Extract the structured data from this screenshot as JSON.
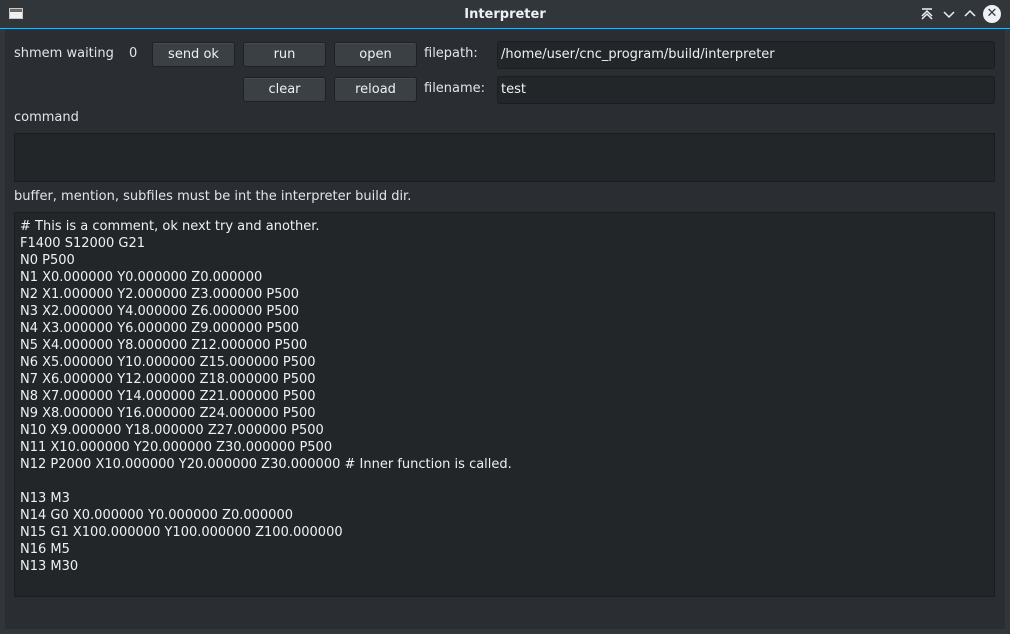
{
  "window": {
    "title": "Interpreter",
    "controls": [
      "keep-above-icon",
      "minimize-icon",
      "maximize-icon",
      "close-icon"
    ]
  },
  "toolbar": {
    "shmem_label": "shmem waiting",
    "shmem_count": "0",
    "send_ok": "send ok",
    "run": "run",
    "open": "open",
    "clear": "clear",
    "reload": "reload",
    "filepath_label": "filepath:",
    "filepath_value": "/home/user/cnc_program/build/interpreter",
    "filename_label": "filename:",
    "filename_value": "test"
  },
  "command": {
    "label": "command",
    "value": ""
  },
  "notice": "buffer, mention, subfiles must be int the interpreter build dir.",
  "editor": {
    "lines": [
      "# This is a comment, ok next try and another.",
      "F1400 S12000 G21",
      "N0 P500",
      "N1 X0.000000 Y0.000000 Z0.000000",
      "N2 X1.000000 Y2.000000 Z3.000000 P500",
      "N3 X2.000000 Y4.000000 Z6.000000 P500",
      "N4 X3.000000 Y6.000000 Z9.000000 P500",
      "N5 X4.000000 Y8.000000 Z12.000000 P500",
      "N6 X5.000000 Y10.000000 Z15.000000 P500",
      "N7 X6.000000 Y12.000000 Z18.000000 P500",
      "N8 X7.000000 Y14.000000 Z21.000000 P500",
      "N9 X8.000000 Y16.000000 Z24.000000 P500",
      "N10 X9.000000 Y18.000000 Z27.000000 P500",
      "N11 X10.000000 Y20.000000 Z30.000000 P500",
      "N12 P2000 X10.000000 Y20.000000 Z30.000000 # Inner function is called.",
      "",
      "N13 M3",
      "N14 G0 X0.000000 Y0.000000 Z0.000000",
      "N15 G1 X100.000000 Y100.000000 Z100.000000",
      "N16 M5",
      "N13 M30"
    ]
  }
}
